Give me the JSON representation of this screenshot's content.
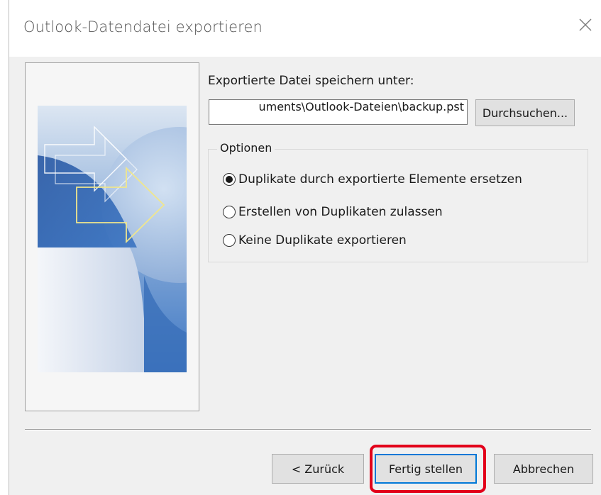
{
  "window": {
    "title": "Outlook-Datendatei exportieren"
  },
  "icons": {
    "close": "close-icon",
    "side_graphic": "outlook-export-arrows-graphic"
  },
  "export": {
    "save_label": "Exportierte Datei speichern unter:",
    "file_path": "uments\\Outlook-Dateien\\backup.pst",
    "browse_label": "Durchsuchen..."
  },
  "options": {
    "legend": "Optionen",
    "items": [
      {
        "label": "Duplikate durch exportierte Elemente ersetzen",
        "selected": true
      },
      {
        "label": "Erstellen von Duplikaten zulassen",
        "selected": false
      },
      {
        "label": "Keine Duplikate exportieren",
        "selected": false
      }
    ]
  },
  "footer": {
    "back_label": "< Zurück",
    "finish_label": "Fertig stellen",
    "cancel_label": "Abbrechen"
  },
  "colors": {
    "accent": "#0078d7",
    "highlight": "#e2001a"
  }
}
